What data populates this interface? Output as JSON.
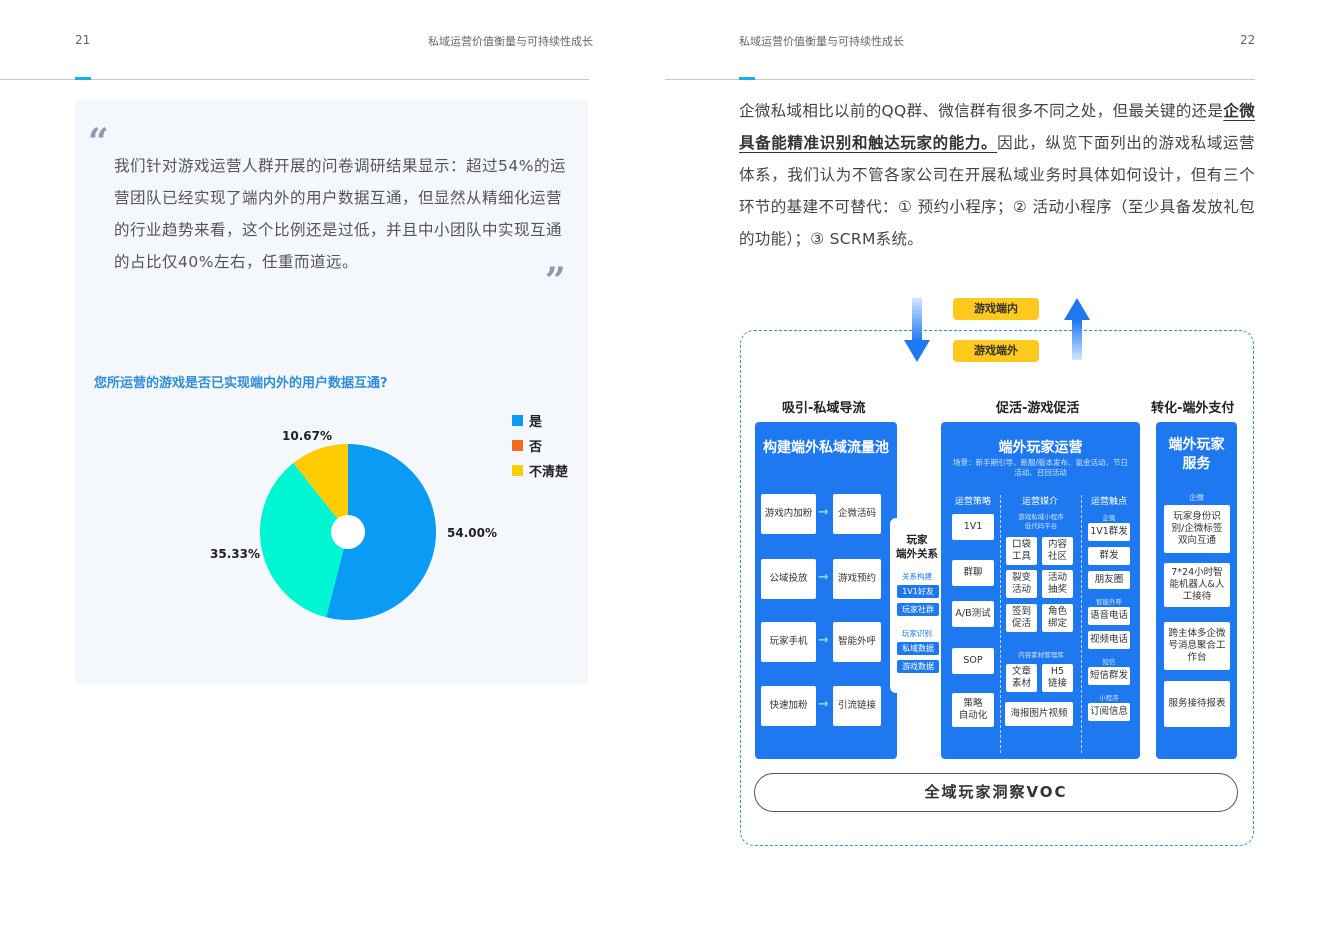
{
  "left_page": {
    "page_number": "21",
    "header": "私域运营价值衡量与可持续性成长",
    "quote_open": "“",
    "quote_close": "”",
    "quote_text": "我们针对游戏运营人群开展的问卷调研结果显示：超过54%的运营团队已经实现了端内外的用户数据互通，但显然从精细化运营的行业趋势来看，这个比例还是过低，并且中小团队中实现互通的占比仅40%左右，任重而道远。",
    "chart_question": "您所运营的游戏是否已实现端内外的用户数据互通?"
  },
  "chart_data": {
    "type": "pie",
    "title": "",
    "categories": [
      "是",
      "否",
      "不清楚"
    ],
    "values": [
      54.0,
      35.33,
      10.67
    ],
    "labels": [
      "54.00%",
      "35.33%",
      "10.67%"
    ],
    "colors": [
      "#0a9bf5",
      "#00f5d2",
      "#ffcc00"
    ],
    "legend_colors": [
      "#0a9bf5",
      "#f26b1d",
      "#ffcc00"
    ],
    "legend_position": "top-right",
    "donut_hole": true
  },
  "right_page": {
    "page_number": "22",
    "header": "私域运营价值衡量与可持续性成长",
    "para_before": "企微私域相比以前的QQ群、微信群有很多不同之处，但最关键的还是",
    "para_bold": "企微具备能精准识别和触达玩家的能力。",
    "para_after": "因此，纵览下面列出的游戏私域运营体系，我们认为不管各家公司在开展私域业务时具体如何设计，但有三个环节的基建不可替代：① 预约小程序；② 活动小程序（至少具备发放礼包的功能）；③ SCRM系统。"
  },
  "diagram": {
    "tag_in": "游戏端内",
    "tag_out": "游戏端外",
    "col1_head": "吸引-私域导流",
    "col2_head": "促活-游戏促活",
    "col3_head": "转化-端外支付",
    "panel1_title": "构建端外私域流量池",
    "panel1_rows": [
      [
        "游戏内加粉",
        "企微活码"
      ],
      [
        "公域投放",
        "游戏预约"
      ],
      [
        "玩家手机",
        "智能外呼"
      ],
      [
        "快速加粉",
        "引流链接"
      ]
    ],
    "middle": {
      "title": "玩家\n端外关系",
      "sub1": "关系构建",
      "btn1": "1V1好友",
      "btn2": "玩家社群",
      "sub2": "玩家识别",
      "btn3": "私域数据",
      "btn4": "游戏数据"
    },
    "panel2_title": "端外玩家运营",
    "panel2_scene": "场景：新手期引导、新服/版本发布、氪金活动、节日活动、召回活动",
    "strategy_head": "运营策略",
    "strategy_items": [
      "1V1",
      "群聊",
      "A/B测试",
      "SOP",
      "策略\n自动化"
    ],
    "media_head": "运营媒介",
    "media_sub1": "游戏私域小程序\n低代码平台",
    "media_grid": [
      [
        "口袋\n工具",
        "内容\n社区"
      ],
      [
        "裂变\n活动",
        "活动\n抽奖"
      ],
      [
        "签到\n促活",
        "角色\n绑定"
      ]
    ],
    "media_sub2": "内容素材管理库",
    "media_grid2": [
      "文章\n素材",
      "H5\n链接"
    ],
    "media_bottom": "海报图片视频",
    "touch_head": "运营触点",
    "touch_groups": [
      {
        "sub": "企微",
        "items": [
          "1V1群发",
          "群发",
          "朋友圈"
        ]
      },
      {
        "sub": "智能外呼",
        "items": [
          "语音电话",
          "视频电话"
        ]
      },
      {
        "sub": "短信",
        "items": [
          "短信群发"
        ]
      },
      {
        "sub": "小程序",
        "items": [
          "订阅信息"
        ]
      }
    ],
    "panel3_title": "端外玩家\n服务",
    "panel3_sub": "企微",
    "panel3_items": [
      "玩家身份识别/企微标签双向互通",
      "7*24小时智能机器人&人工接待",
      "跨主体多企微号消息聚合工作台",
      "服务接待报表"
    ],
    "voc": "全域玩家洞察VOC"
  }
}
